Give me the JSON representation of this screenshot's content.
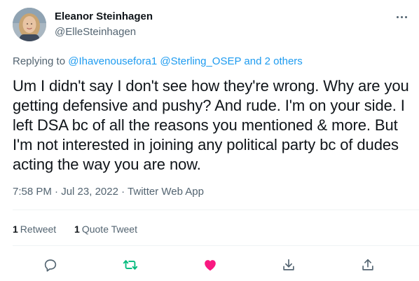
{
  "author": {
    "name": "Eleanor Steinhagen",
    "handle": "@ElleSteinhagen"
  },
  "reply": {
    "prefix": "Replying to",
    "mention1": "@Ihavenousefora1",
    "mention2": "@Sterling_OSEP",
    "connector": "and",
    "others": "2 others"
  },
  "tweet": {
    "text": "Um I didn't say I don't see how they're wrong. Why are you getting defensive and pushy? And rude. I'm on your side. I left DSA bc of all the reasons you mentioned & more. But I'm not interested in joining any political party bc of dudes acting the way you are now."
  },
  "meta": {
    "time": "7:58 PM",
    "separator1": "·",
    "date": "Jul 23, 2022",
    "separator2": "·",
    "source": "Twitter Web App"
  },
  "stats": {
    "retweets_count": "1",
    "retweets_label": "Retweet",
    "quotes_count": "1",
    "quotes_label": "Quote Tweet"
  },
  "colors": {
    "link": "#1d9bf0",
    "retweet": "#00ba7c",
    "like": "#f91880",
    "muted": "#536471",
    "text": "#0f1419"
  },
  "icons": {
    "reply": "reply-icon",
    "retweet": "retweet-icon",
    "like": "heart-filled-icon",
    "bookmark": "bookmark-arrow-icon",
    "share": "share-icon",
    "more": "more-dots-icon"
  }
}
